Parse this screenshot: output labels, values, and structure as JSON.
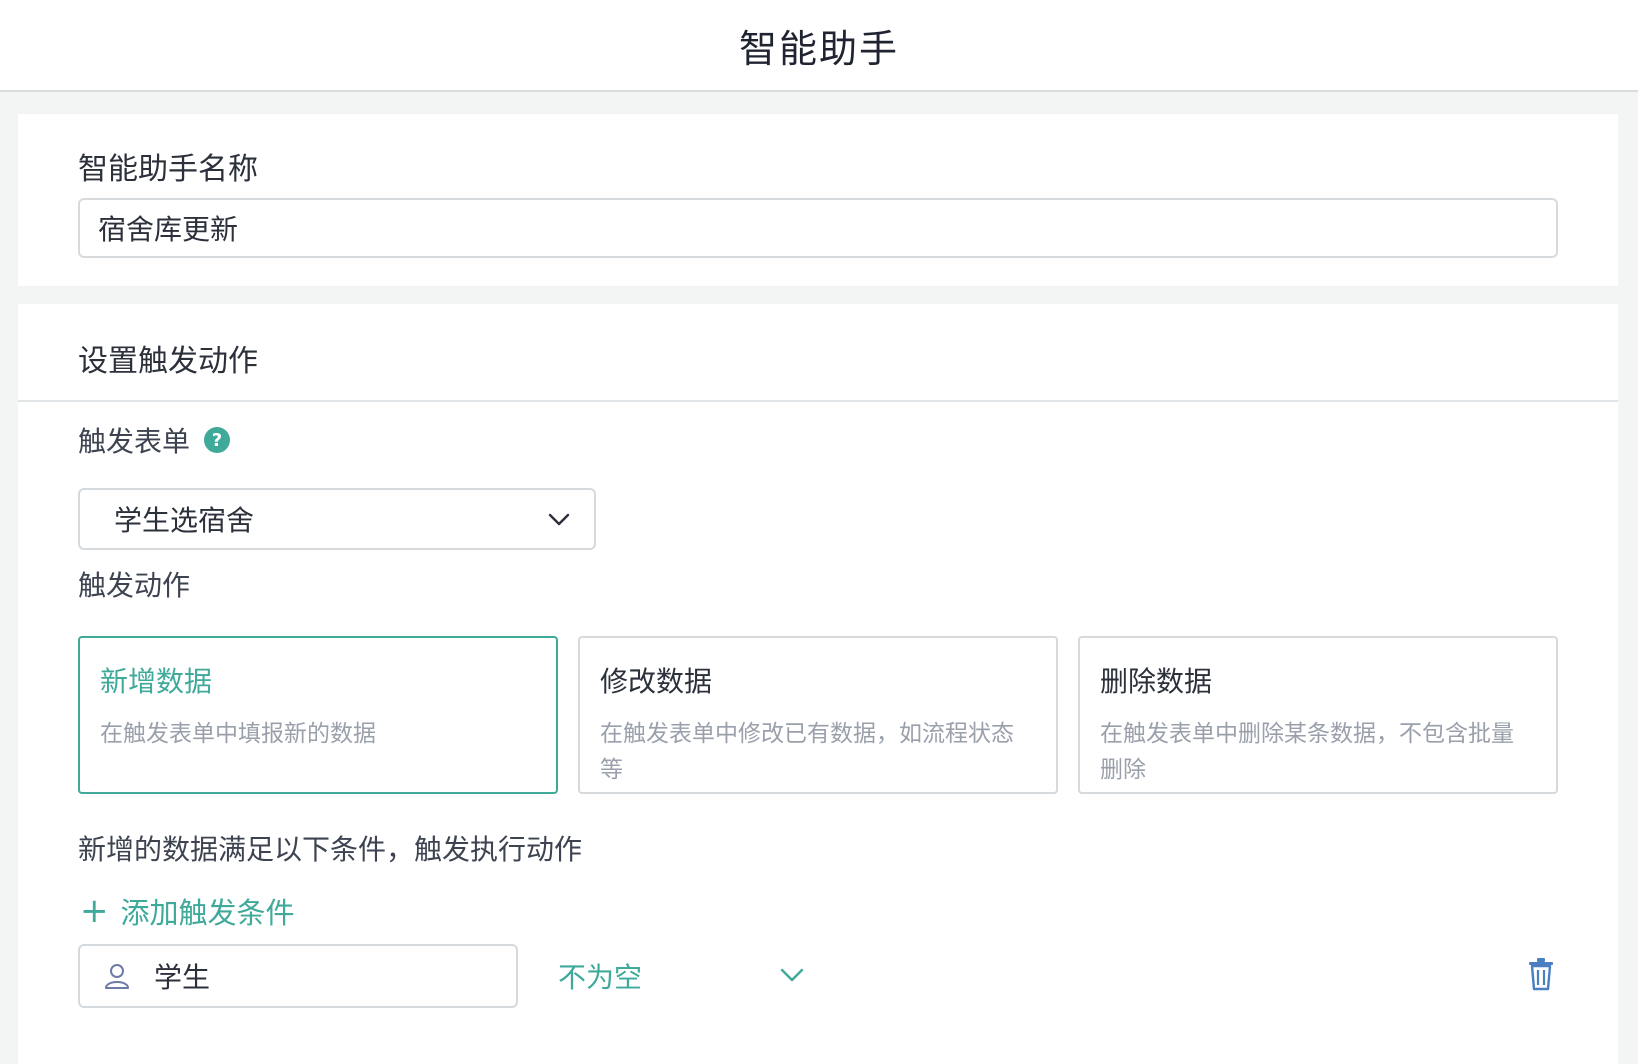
{
  "header": {
    "title": "智能助手"
  },
  "name_section": {
    "label": "智能助手名称",
    "value": "宿舍库更新"
  },
  "trigger_section": {
    "title": "设置触发动作",
    "form_label": "触发表单",
    "help_glyph": "?",
    "form_value": "学生选宿舍",
    "action_label": "触发动作",
    "actions": [
      {
        "title": "新增数据",
        "desc": "在触发表单中填报新的数据",
        "selected": true
      },
      {
        "title": "修改数据",
        "desc": "在触发表单中修改已有数据，如流程状态等",
        "selected": false
      },
      {
        "title": "删除数据",
        "desc": "在触发表单中删除某条数据，不包含批量删除",
        "selected": false
      }
    ],
    "condition_text": "新增的数据满足以下条件，触发执行动作",
    "add_condition_plus": "+",
    "add_condition_label": "添加触发条件",
    "condition": {
      "field": "学生",
      "operator": "不为空"
    }
  },
  "colors": {
    "accent": "#3fa99a",
    "border": "#d6dadd",
    "muted_text": "#9aa0ab"
  },
  "icons": [
    "help-icon",
    "chevron-down-icon",
    "user-icon",
    "trash-icon",
    "plus-icon"
  ]
}
